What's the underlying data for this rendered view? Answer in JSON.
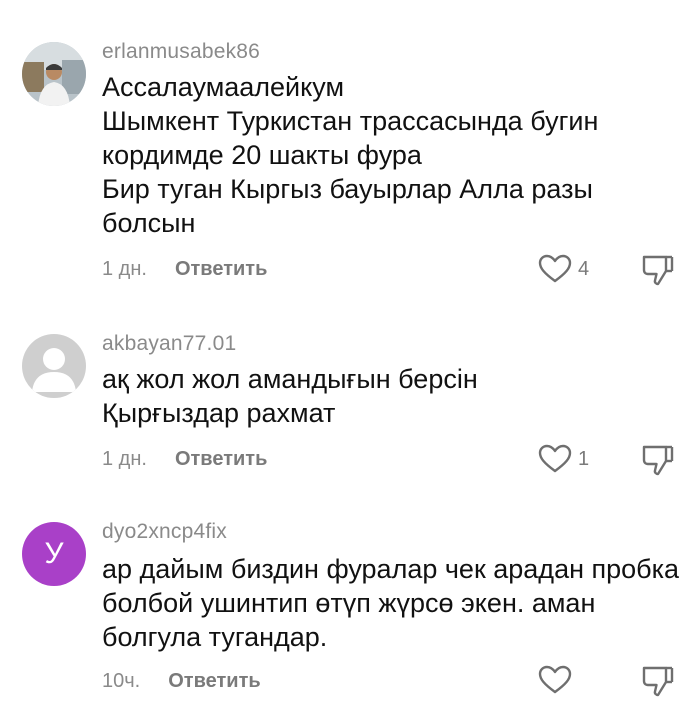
{
  "comments": [
    {
      "username": "erlanmusabek86",
      "text": "Ассалаумаалейкум\nШымкент Туркистан трассасында бугин кордимде 20 шакты фура\nБир туган Кыргыз бауырлар Алла разы болсын",
      "time": "1 дн.",
      "reply_label": "Ответить",
      "like_count": "4"
    },
    {
      "username": "akbayan77.01",
      "text": "ақ жол жол амандығын берсін\nҚырғыздар рахмат",
      "time": "1 дн.",
      "reply_label": "Ответить",
      "like_count": "1"
    },
    {
      "username": "dyo2xncp4fix",
      "avatar_letter": "У",
      "text": "ар дайым биздин фуралар чек арадан пробка болбой ушинтип өтүп жүрсө экен. аман болгула тугандар.",
      "time": "10ч.",
      "reply_label": "Ответить",
      "like_count": ""
    }
  ],
  "colors": {
    "username": "#8a8a8a",
    "text": "#111111",
    "avatar_purple": "#a940c8",
    "avatar_grey": "#c8c8c8"
  }
}
